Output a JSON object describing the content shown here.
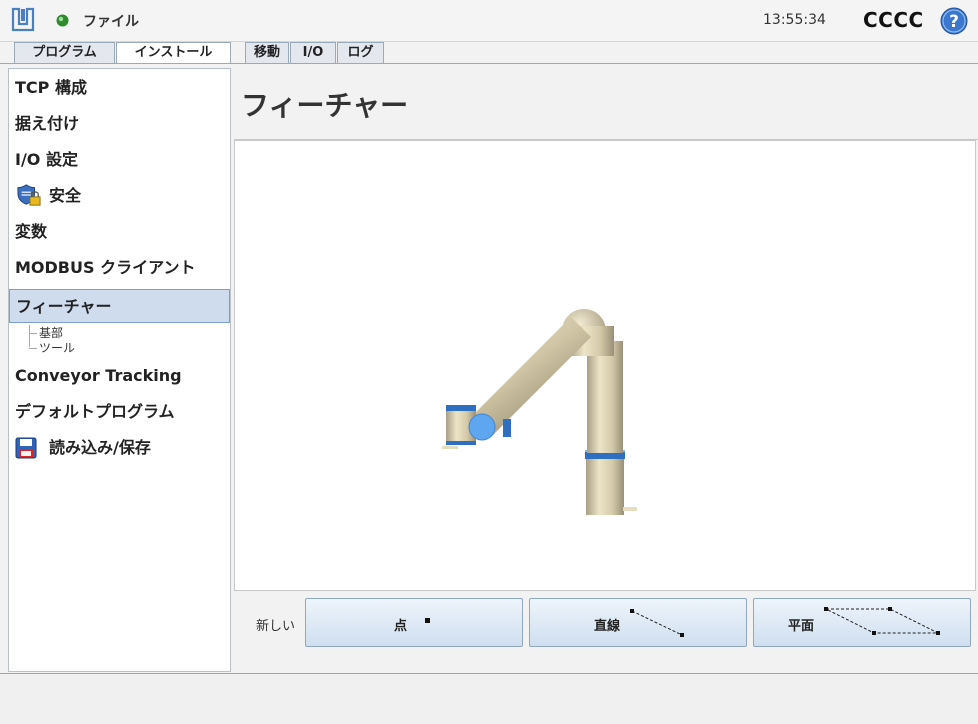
{
  "topbar": {
    "file_label": "ファイル",
    "clock": "13:55:34",
    "robot_name": "CCCC",
    "status_color": "#2e8b2e"
  },
  "tabs": [
    {
      "label": "プログラム",
      "active": false
    },
    {
      "label": "インストール",
      "active": true
    },
    {
      "label": "移動",
      "active": false
    },
    {
      "label": "I/O",
      "active": false
    },
    {
      "label": "ログ",
      "active": false
    }
  ],
  "sidebar": {
    "items": [
      {
        "label": "TCP 構成"
      },
      {
        "label": "据え付け"
      },
      {
        "label": "I/O 設定"
      },
      {
        "label": "安全",
        "icon": "shield-lock-icon"
      },
      {
        "label": "変数"
      },
      {
        "label": "MODBUS クライアント"
      },
      {
        "label": "フィーチャー",
        "selected": true
      },
      {
        "label": "Conveyor Tracking"
      },
      {
        "label": "デフォルトプログラム"
      },
      {
        "label": "読み込み/保存",
        "icon": "floppy-icon"
      }
    ],
    "sub_items": [
      {
        "label": "基部"
      },
      {
        "label": "ツール"
      }
    ]
  },
  "main": {
    "title": "フィーチャー",
    "new_label": "新しい",
    "buttons": [
      {
        "label": "点",
        "icon": "point-icon"
      },
      {
        "label": "直線",
        "icon": "line-icon"
      },
      {
        "label": "平面",
        "icon": "plane-icon"
      }
    ]
  },
  "colors": {
    "accent": "#7ea0cc",
    "selected_bg": "#cfdcee",
    "robot_body": "#d8cdb0",
    "robot_ring": "#2f6fc2",
    "tcp_ball": "#5fa6f0"
  }
}
